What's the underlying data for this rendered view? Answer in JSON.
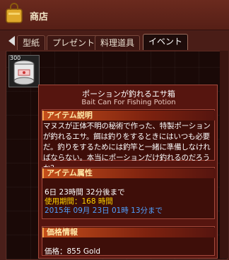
{
  "window": {
    "title": "商店",
    "icon": "shopping-bag-icon"
  },
  "tabs": [
    {
      "label": "型紙",
      "active": false
    },
    {
      "label": "プレゼント",
      "active": false
    },
    {
      "label": "料理道具",
      "active": false
    },
    {
      "label": "イベント",
      "active": true
    }
  ],
  "item": {
    "count": "300"
  },
  "tooltip": {
    "title": "ポーションが釣れるエサ箱",
    "subtitle": "Bait Can For Fishing Potion",
    "desc_header": "アイテム説明",
    "desc": "マヌスが正体不明の秘術で作った、特製ポーションが釣れるエサ。餌は釣りをするときにはいつも必要だ。釣りをするためには釣竿と一緒に準備しなければならない。本当にポーションだけ釣れるのだろうか？",
    "attr_header": "アイテム属性",
    "attr_remaining": "6日 23時間 32分後まで",
    "attr_period": "使用期間：168 時間",
    "attr_expiry": "2015年 09月 23日 01時 13分まで",
    "price_header": "価格情報",
    "price": "価格：855 Gold"
  },
  "colors": {
    "accent": "#c34d1a",
    "yellow": "#ffd400",
    "blue": "#4fa0ff"
  }
}
